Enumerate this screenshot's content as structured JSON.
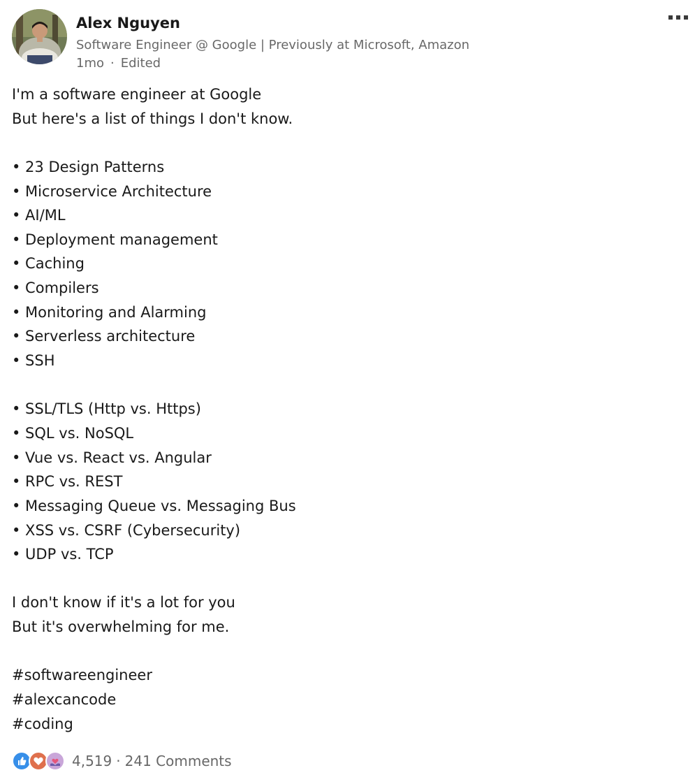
{
  "author": {
    "name": "Alex Nguyen",
    "headline": "Software Engineer @ Google | Previously at Microsoft, Amazon",
    "time": "1mo",
    "separator": "·",
    "edited": "Edited"
  },
  "post": {
    "lines": [
      "I'm a software engineer at Google",
      "But here's a list of things I don't know.",
      "",
      "• 23 Design Patterns",
      "• Microservice Architecture",
      "• AI/ML",
      "• Deployment management",
      "• Caching",
      "• Compilers",
      "• Monitoring and Alarming",
      "• Serverless architecture",
      "• SSH",
      "",
      "• SSL/TLS (Http vs. Https)",
      "• SQL vs. NoSQL",
      "• Vue vs. React vs. Angular",
      "• RPC vs. REST",
      "• Messaging Queue vs. Messaging Bus",
      "• XSS vs. CSRF (Cybersecurity)",
      "• UDP vs. TCP",
      "",
      "I don't know if it's a lot for you",
      "But it's overwhelming for me.",
      "",
      "#softwareengineer",
      "#alexcancode",
      "#coding"
    ]
  },
  "social": {
    "reaction_icons": [
      "like-icon",
      "love-icon",
      "support-icon"
    ],
    "reaction_count": "4,519",
    "separator": "·",
    "comments": "241 Comments"
  },
  "colors": {
    "like": "#378fe9",
    "love": "#df704d",
    "support": "#c9a6d9",
    "more_icon": "#3a3a3a"
  }
}
